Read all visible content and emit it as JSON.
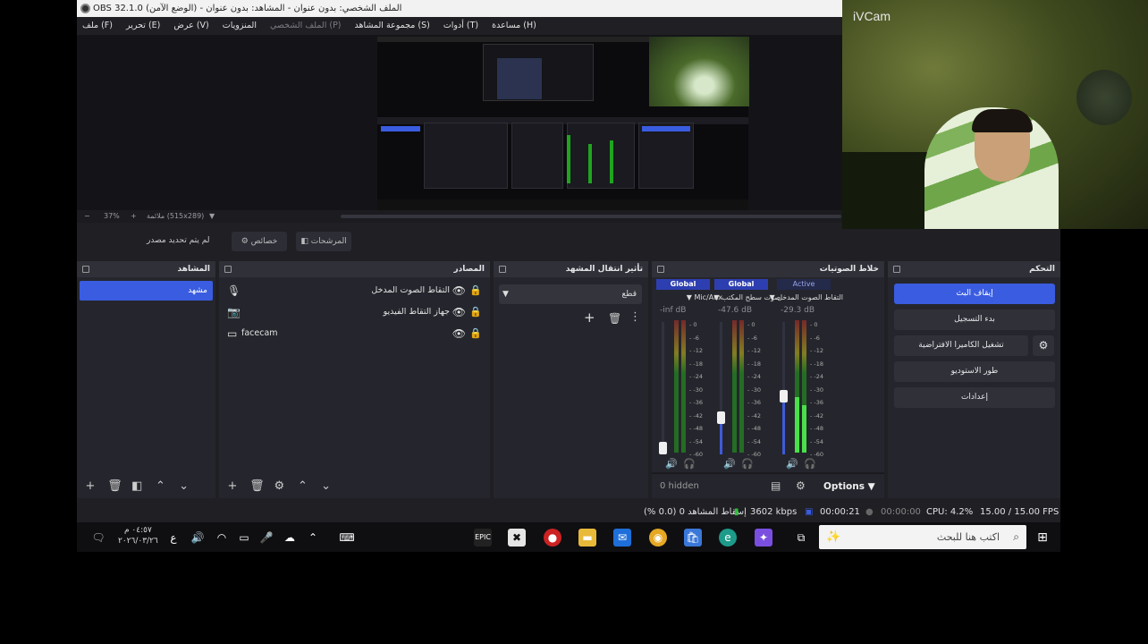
{
  "window": {
    "title": "OBS 32.1.0 (الوضع الآمن) - الملف الشخصي: بدون عنوان - المشاهد: بدون عنوان"
  },
  "menu": [
    {
      "label": "ملف (F)",
      "enabled": true
    },
    {
      "label": "تحرير (E)",
      "enabled": true
    },
    {
      "label": "عرض (V)",
      "enabled": true
    },
    {
      "label": "المنزويات",
      "enabled": true
    },
    {
      "label": "الملف الشخصي (P)",
      "enabled": false
    },
    {
      "label": "مجموعة المشاهد (S)",
      "enabled": true
    },
    {
      "label": "أدوات (T)",
      "enabled": true
    },
    {
      "label": "مساعدة (H)",
      "enabled": true
    }
  ],
  "preview": {
    "zoom": "37%",
    "mode": "ملائمة (515x289)"
  },
  "toolbar": {
    "no_source": "لم يتم تحديد مصدر",
    "properties": "خصائص",
    "filters": "المرشحات"
  },
  "scenes": {
    "title": "المشاهد",
    "items": [
      "مشهد"
    ]
  },
  "sources": {
    "title": "المصادر",
    "items": [
      {
        "name": "التقاط الصوت المدخل",
        "icon": "microphone-icon"
      },
      {
        "name": "جهاز التقاط الفيديو",
        "icon": "camera-icon"
      },
      {
        "name": "facecam",
        "icon": "monitor-icon"
      }
    ]
  },
  "transitions": {
    "title": "تأثير انتقال المشهد",
    "selected": "قطع"
  },
  "mixer": {
    "title": "خلاط الصوتيات",
    "channels": [
      {
        "tag": "Global",
        "name": "Mic/Aux",
        "db": "-inf dB",
        "level": 0,
        "fader": 0.05
      },
      {
        "tag": "Global",
        "name": "صوت سطح المكتب",
        "db": "-47.6 dB",
        "level": 0,
        "fader": 0.28
      },
      {
        "tag": "Active",
        "name": "التقاط الصوت المدخل",
        "db": "-29.3 dB",
        "level": 0.42,
        "fader": 0.44
      }
    ],
    "scale": [
      "0",
      "-6",
      "-12",
      "-18",
      "-24",
      "-30",
      "-36",
      "-42",
      "-48",
      "-54",
      "-60"
    ],
    "hidden": "0 hidden",
    "options": "Options"
  },
  "controls": {
    "title": "التحكم",
    "buttons": [
      "إيقاف البث",
      "بدء التسجيل",
      "تشغيل الكاميرا الافتراضية",
      "طور الاستوديو",
      "إعدادات"
    ]
  },
  "status": {
    "dropped": "إسقاط المشاهد 0 (0.0 %)",
    "bitrate": "3602 kbps",
    "stream_time": "00:00:21",
    "rec_time": "00:00:00",
    "cpu": "CPU: 4.2%",
    "fps": "15.00 / 15.00 FPS"
  },
  "taskbar": {
    "search_placeholder": "اكتب هنا للبحث",
    "clock_time": "٠٤:٥٧ م",
    "clock_date": "٢٠٢٦/٠٣/٢٦",
    "lang": "ع"
  },
  "ivcam": {
    "title": "iVCam"
  }
}
